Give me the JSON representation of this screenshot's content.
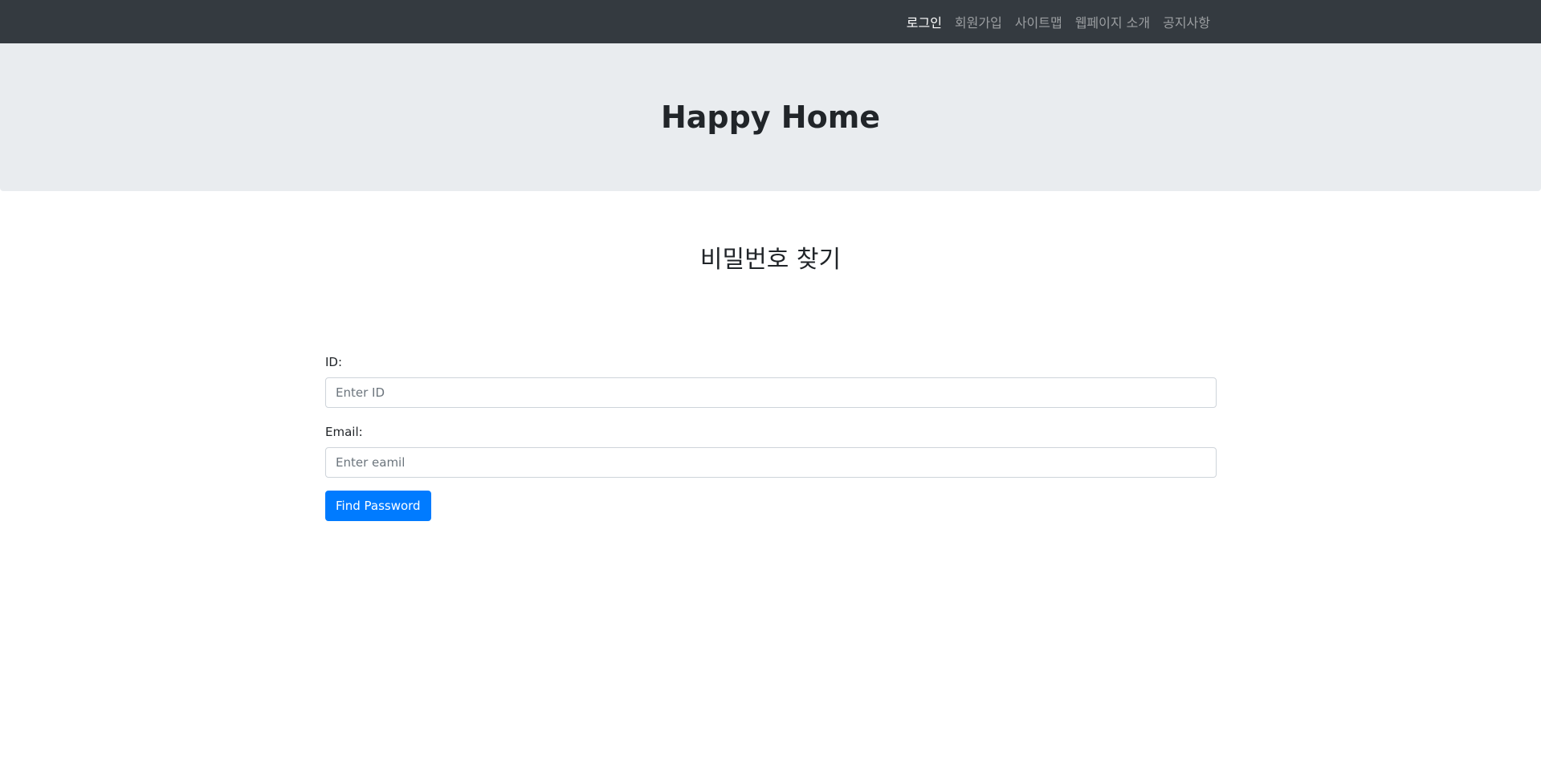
{
  "navbar": {
    "links": [
      {
        "label": "로그인",
        "active": true
      },
      {
        "label": "회원가입"
      },
      {
        "label": "사이트맵"
      },
      {
        "label": "웹페이지 소개"
      },
      {
        "label": "공지사항"
      }
    ],
    "background": "#343a40"
  },
  "jumbotron": {
    "title": "Happy Home",
    "background": "#e9ecef"
  },
  "main": {
    "title": "비밀번호 찾기",
    "form": {
      "id_label": "ID:",
      "id_placeholder": "Enter ID",
      "id_value": "",
      "email_label": "Email:",
      "email_placeholder": "Enter eamil",
      "email_value": "",
      "submit_label": "Find Password"
    }
  },
  "colors": {
    "primary": "#007bff"
  }
}
